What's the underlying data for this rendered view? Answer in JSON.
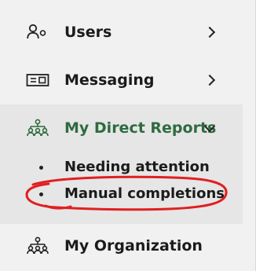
{
  "nav": {
    "items": [
      {
        "label": "Users",
        "icon": "users-icon",
        "chevron": "chevron-right-icon"
      },
      {
        "label": "Messaging",
        "icon": "messaging-icon",
        "chevron": "chevron-right-icon"
      },
      {
        "label": "My Direct Reports",
        "icon": "org-hierarchy-icon",
        "chevron": "chevron-down-icon",
        "expanded": true,
        "subitems": [
          {
            "label": "Needing attention"
          },
          {
            "label": "Manual completions"
          }
        ]
      },
      {
        "label": "My Organization",
        "icon": "org-hierarchy-icon"
      }
    ]
  },
  "colors": {
    "active_green": "#2e6b3f",
    "annotation_red": "#e02020",
    "sidebar_bg": "#f1f1f1",
    "expanded_bg": "#e6e6e6"
  }
}
